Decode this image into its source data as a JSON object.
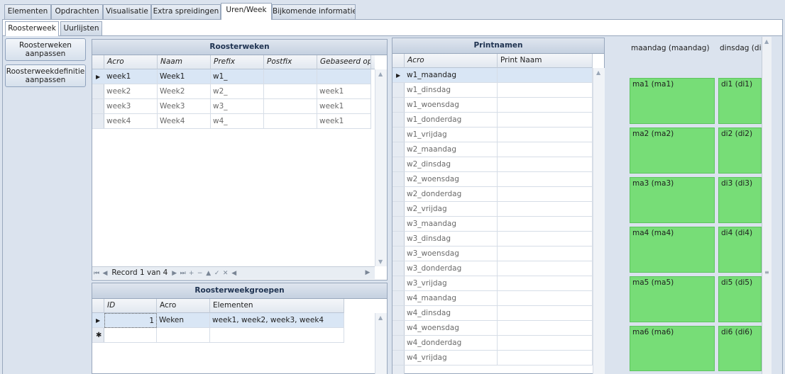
{
  "tabs": [
    "Elementen",
    "Opdrachten",
    "Visualisatie",
    "Extra spreidingen",
    "Uren/Week",
    "Bijkomende informatie"
  ],
  "active_tab": "Uren/Week",
  "subtabs": [
    "Roosterweek",
    "Uurlijsten"
  ],
  "buttons": {
    "roosterweken_aanpassen": "Roosterweken\naanpassen",
    "roosterweekdefinitie_aanpassen": "Roosterweekdefinitie\naanpassen"
  },
  "roosterweken": {
    "title": "Roosterweken",
    "columns": [
      "Acro",
      "Naam",
      "Prefix",
      "Postfix",
      "Gebaseerd op"
    ],
    "rows": [
      [
        "week1",
        "Week1",
        "w1_",
        "",
        ""
      ],
      [
        "week2",
        "Week2",
        "w2_",
        "",
        "week1"
      ],
      [
        "week3",
        "Week3",
        "w3_",
        "",
        "week1"
      ],
      [
        "week4",
        "Week4",
        "w4_",
        "",
        "week1"
      ]
    ],
    "record_text": "Record 1 van 4"
  },
  "groepen": {
    "title": "Roosterweekgroepen",
    "columns": [
      "ID",
      "Acro",
      "Elementen"
    ],
    "rows": [
      [
        "1",
        "Weken",
        "week1, week2, week3, week4"
      ]
    ]
  },
  "printnamen": {
    "title": "Printnamen",
    "columns": [
      "Acro",
      "Print Naam"
    ],
    "rows": [
      "w1_maandag",
      "w1_dinsdag",
      "w1_woensdag",
      "w1_donderdag",
      "w1_vrijdag",
      "w2_maandag",
      "w2_dinsdag",
      "w2_woensdag",
      "w2_donderdag",
      "w2_vrijdag",
      "w3_maandag",
      "w3_dinsdag",
      "w3_woensdag",
      "w3_donderdag",
      "w3_vrijdag",
      "w4_maandag",
      "w4_dinsdag",
      "w4_woensdag",
      "w4_donderdag",
      "w4_vrijdag"
    ]
  },
  "schedule": {
    "days": [
      "maandag (maandag)",
      "dinsdag (dinsdag)"
    ],
    "col1": [
      "ma1 (ma1)",
      "ma2 (ma2)",
      "ma3 (ma3)",
      "ma4 (ma4)",
      "ma5 (ma5)",
      "ma6 (ma6)"
    ],
    "col2": [
      "di1 (di1)",
      "di2 (di2)",
      "di3 (di3)",
      "di4 (di4)",
      "di5 (di5)",
      "di6 (di6)"
    ],
    "tile_color": "#77dd77"
  }
}
